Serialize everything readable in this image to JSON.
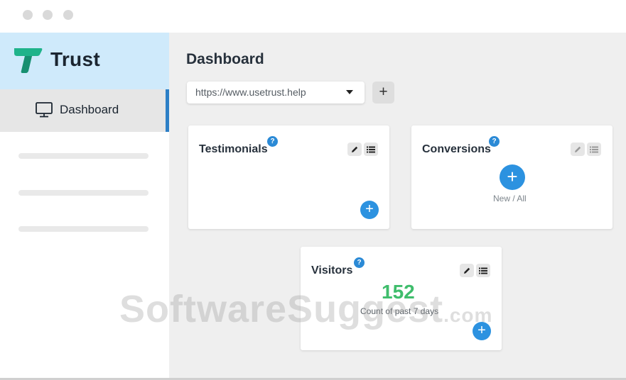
{
  "window": {
    "controls": [
      "close",
      "minimize",
      "maximize"
    ]
  },
  "brand": {
    "name": "Trust",
    "logo_color": "#1fb38a",
    "icon": "trust-logo-icon"
  },
  "sidebar": {
    "items": [
      {
        "label": "Dashboard",
        "icon": "monitor-icon",
        "active": true
      }
    ],
    "accent": "#2d7fc6"
  },
  "main": {
    "title": "Dashboard",
    "site_select": {
      "value": "https://www.usetrust.help"
    },
    "add_site_label": "+"
  },
  "widgets": {
    "testimonials": {
      "title": "Testimonials",
      "help": "?",
      "add": "+"
    },
    "conversions": {
      "title": "Conversions",
      "help": "?",
      "add": "+",
      "caption": "New / All"
    },
    "visitors": {
      "title": "Visitors",
      "help": "?",
      "add": "+",
      "count": "152",
      "caption": "Count of past 7 days"
    }
  },
  "watermark": {
    "text": "SoftwareSuggest",
    "suffix": ".com"
  },
  "colors": {
    "primary": "#2c92e0",
    "success": "#3fbd6c",
    "brand_bg": "#cfeafb"
  }
}
